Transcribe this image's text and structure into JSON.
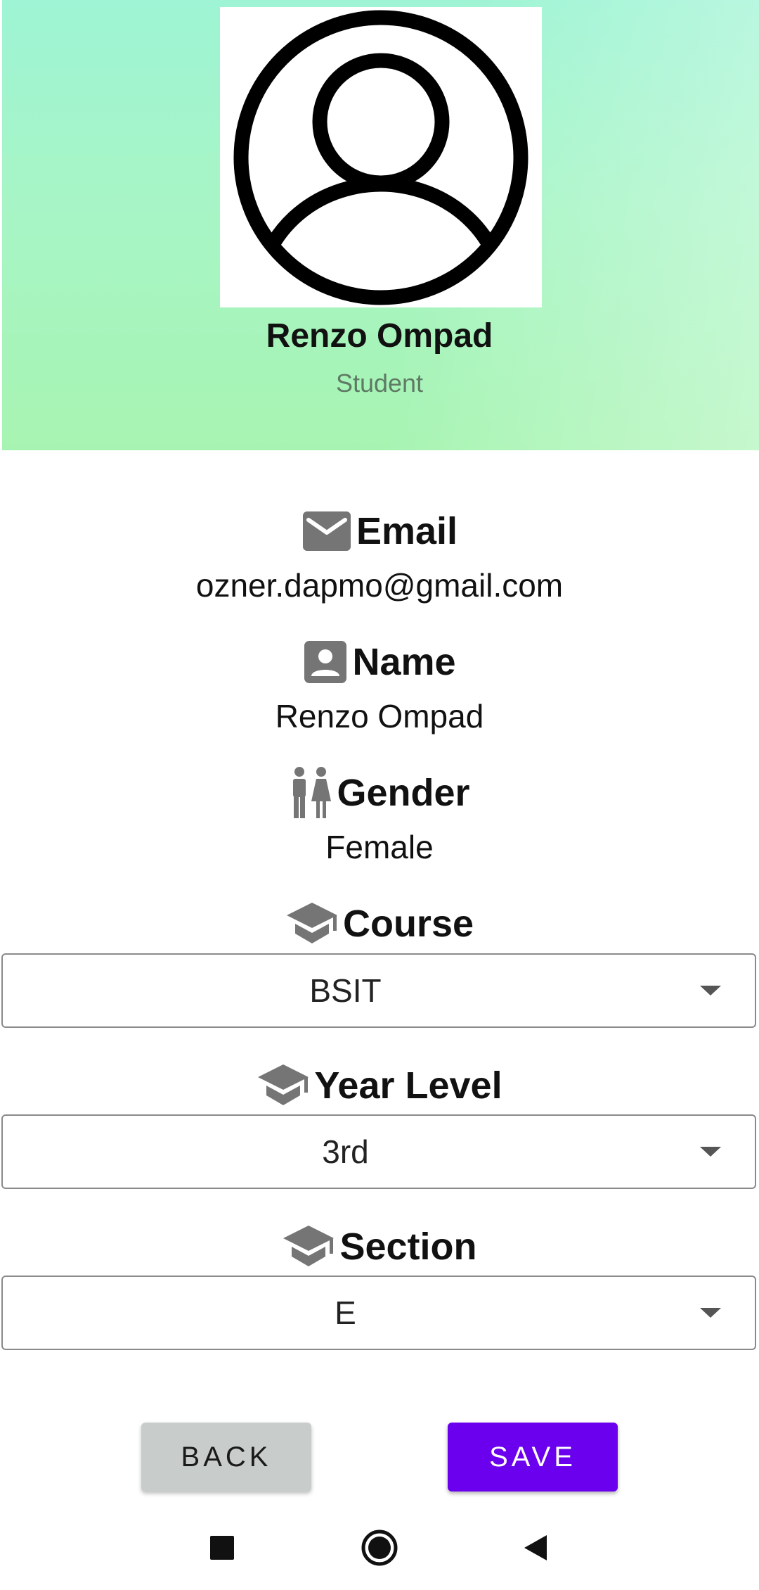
{
  "profile": {
    "name": "Renzo Ompad",
    "role": "Student"
  },
  "fields": {
    "email": {
      "label": "Email",
      "value": "ozner.dapmo@gmail.com",
      "icon": "mail-icon"
    },
    "name": {
      "label": "Name",
      "value": "Renzo Ompad",
      "icon": "account-box-icon"
    },
    "gender": {
      "label": "Gender",
      "value": "Female",
      "icon": "wc-icon"
    },
    "course": {
      "label": "Course",
      "selected": "BSIT",
      "icon": "school-icon"
    },
    "year_level": {
      "label": "Year Level",
      "selected": "3rd",
      "icon": "school-icon"
    },
    "section": {
      "label": "Section",
      "selected": "E",
      "icon": "school-icon"
    }
  },
  "buttons": {
    "back": "BACK",
    "save": "SAVE"
  },
  "colors": {
    "header_gradient_top": "#9ef4d4",
    "header_gradient_bottom": "#a7f4b2",
    "icon_gray": "#757575",
    "save_button": "#6a00ee",
    "back_button": "#c8cccb",
    "role_text": "#5f7a64"
  },
  "system_nav": [
    "recents-square-icon",
    "home-circle-icon",
    "back-triangle-icon"
  ]
}
